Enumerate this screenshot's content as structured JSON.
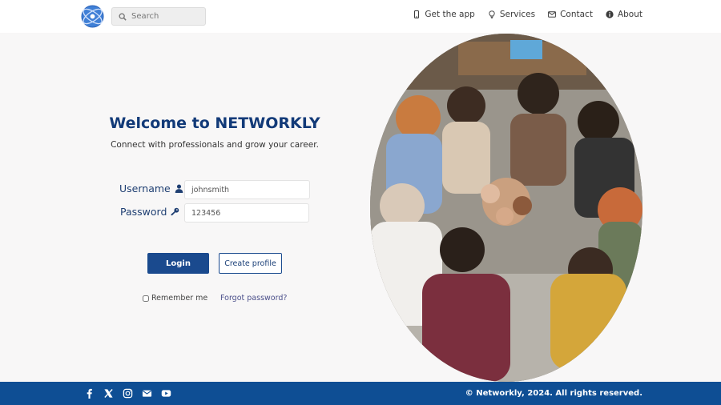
{
  "header": {
    "search_placeholder": "Search",
    "nav": [
      {
        "label": "Get the app",
        "icon": "phone-icon"
      },
      {
        "label": "Services",
        "icon": "lightbulb-icon"
      },
      {
        "label": "Contact",
        "icon": "envelope-icon"
      },
      {
        "label": "About",
        "icon": "info-icon"
      }
    ]
  },
  "login": {
    "title": "Welcome to NETWORKLY",
    "tagline": "Connect with professionals and grow your career.",
    "username_label": "Username",
    "username_value": "johnsmith",
    "password_label": "Password",
    "password_value": "123456",
    "login_button": "Login",
    "create_button": "Create profile",
    "remember_label": "Remember me",
    "forgot_link": "Forgot password?"
  },
  "footer": {
    "socials": [
      "facebook-icon",
      "x-icon",
      "instagram-icon",
      "email-icon",
      "youtube-icon"
    ],
    "copyright": "© Networkly, 2024. All rights reserved."
  },
  "colors": {
    "brand_navy": "#123a78",
    "button_blue": "#1a4a8e",
    "footer_blue": "#0e4e94",
    "page_background": "#f8f7f7"
  }
}
